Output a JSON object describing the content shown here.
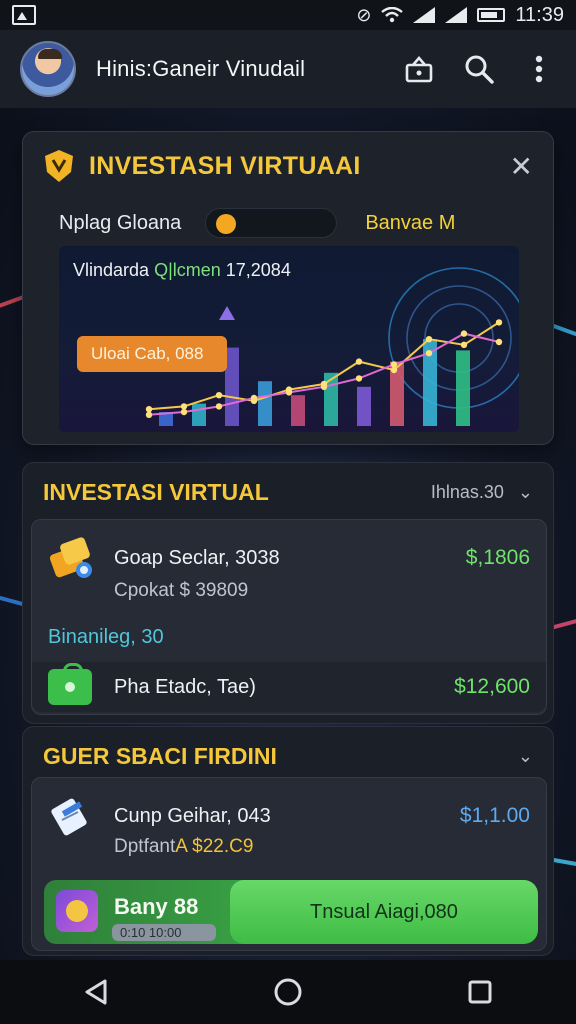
{
  "status_bar": {
    "time": "11:39"
  },
  "header": {
    "title": "Hinis:Ganeir Vinudail"
  },
  "top_card": {
    "title": "INVESTASH VIRTUAAI",
    "row_label": "Nplag Gloana",
    "row_value": "Banvae M",
    "chart_caption_prefix": "Vlindarda ",
    "chart_caption_highlight": "Q|lcmen",
    "chart_caption_suffix": " 17,2084",
    "chart_chip": "Uloai Cab, 088"
  },
  "section_investasi": {
    "title": "INVESTASI VIRTUAL",
    "meta": "Ihlnas.30",
    "item": {
      "name": "Goap Seclar, 3038",
      "amount": "$,1806",
      "sub": "Cpokat $ 39809",
      "note": "Binanileg, 30",
      "sub_row_label": "Pha Etadc, Tae)",
      "sub_row_amount": "$12,600"
    }
  },
  "section_guer": {
    "title": "GUER SBACI FIRDINI",
    "item": {
      "name": "Cunp Geihar, 043",
      "amount": "$1,1.00",
      "sub_prefix": "Dptfant ",
      "sub_highlight": "A $22.C9"
    },
    "cta": {
      "left_label": "Bany 88",
      "left_pill": "0:10 10:00",
      "button": "Tnsual Aiagi,080"
    }
  },
  "chart_data": {
    "type": "line",
    "title": "",
    "x": [
      1,
      2,
      3,
      4,
      5,
      6,
      7,
      8,
      9,
      10,
      11
    ],
    "series": [
      {
        "values": [
          12,
          14,
          22,
          18,
          26,
          30,
          46,
          40,
          62,
          58,
          74
        ]
      },
      {
        "values": [
          8,
          10,
          14,
          20,
          24,
          28,
          34,
          44,
          52,
          66,
          60
        ]
      }
    ],
    "bars": [
      10,
      16,
      56,
      32,
      22,
      38,
      28,
      46,
      62,
      54
    ],
    "ylim": [
      0,
      100
    ],
    "grid": false
  },
  "colors": {
    "accent_yellow": "#f5c83b",
    "green": "#6fe36a",
    "blue": "#5eaaf0",
    "orange": "#e8882d"
  }
}
